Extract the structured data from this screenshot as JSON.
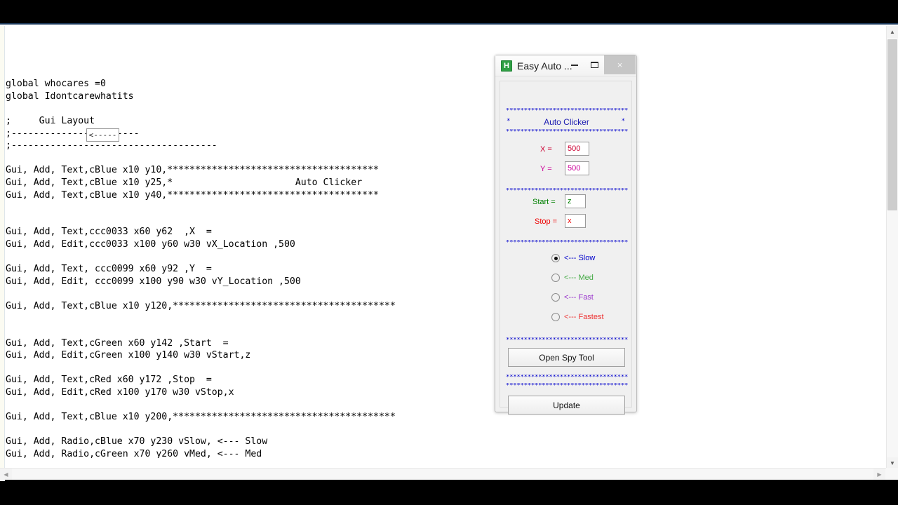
{
  "editor": {
    "code": "global whocares =0\nglobal Idontcarewhatits\n\n;     Gui Layout\n;-----------------------\n;-------------------------------------\n\nGui, Add, Text,cBlue x10 y10,**************************************\nGui, Add, Text,cBlue x10 y25,*                      Auto Clicker                          *\nGui, Add, Text,cBlue x10 y40,**************************************\n\n\nGui, Add, Text,ccc0033 x60 y62  ,X  =\nGui, Add, Edit,ccc0033 x100 y60 w30 vX_Location ,500\n\nGui, Add, Text, ccc0099 x60 y92 ,Y  =\nGui, Add, Edit, ccc0099 x100 y90 w30 vY_Location ,500\n\nGui, Add, Text,cBlue x10 y120,****************************************\n\n\nGui, Add, Text,cGreen x60 y142 ,Start  =\nGui, Add, Edit,cGreen x100 y140 w30 vStart,z\n\nGui, Add, Text,cRed x60 y172 ,Stop  =\nGui, Add, Edit,cRed x100 y170 w30 vStop,x\n\nGui, Add, Text,cBlue x10 y200,****************************************\n\nGui, Add, Radio,cBlue x70 y230 vSlow, <--- Slow\nGui, Add, Radio,cGreen x70 y260 vMed, <--- Med",
    "tooltip_text": "<------",
    "scroll_up_glyph": "▲",
    "scroll_down_glyph": "▼",
    "scroll_left_glyph": "◀",
    "scroll_right_glyph": "▶"
  },
  "app": {
    "title": "Easy Auto ...",
    "icon_letter": "H",
    "icon_color": "#2f9e44",
    "window_buttons": {
      "minimize": "minimize",
      "maximize": "maximize",
      "close": "×"
    },
    "header": {
      "title": "Auto Clicker",
      "star_rule": "********************************************",
      "side_star": "*",
      "color": "#1a1ab0"
    },
    "rule_color": "#0000cc",
    "fields": [
      {
        "label": "X  =",
        "value": "500",
        "color": "#cc0033"
      },
      {
        "label": "Y  =",
        "value": "500",
        "color": "#cc0099"
      },
      {
        "label": "Start  =",
        "value": "z",
        "color": "#008000"
      },
      {
        "label": "Stop  =",
        "value": "x",
        "color": "#ee0000"
      }
    ],
    "radios": [
      {
        "label": "<--- Slow",
        "color": "#0000cc",
        "checked": true
      },
      {
        "label": "<--- Med",
        "color": "#44aa44",
        "checked": false
      },
      {
        "label": "<--- Fast",
        "color": "#9933cc",
        "checked": false
      },
      {
        "label": "<--- Fastest",
        "color": "#ee3333",
        "checked": false
      }
    ],
    "buttons": [
      {
        "label": "Open Spy Tool"
      },
      {
        "label": "Update"
      }
    ]
  }
}
